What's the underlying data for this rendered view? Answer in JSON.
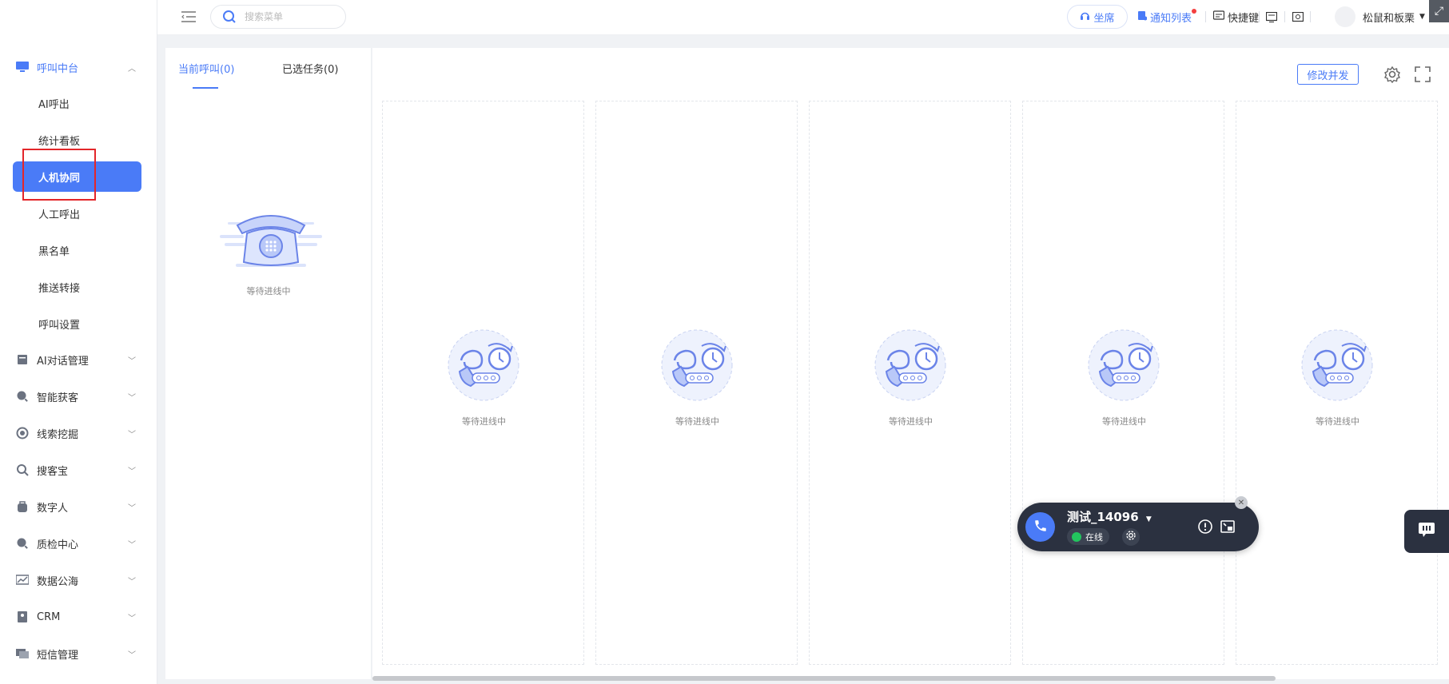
{
  "search": {
    "placeholder": "搜索菜单"
  },
  "topbar": {
    "seat_label": "坐席",
    "notify_label": "通知列表",
    "shortcut_label": "快捷键",
    "username": "松鼠和板栗"
  },
  "sidebar": {
    "items": [
      {
        "label": "呼叫中台",
        "icon": "monitor-icon",
        "expanded": true
      },
      {
        "label": "AI对话管理",
        "icon": "book-icon"
      },
      {
        "label": "智能获客",
        "icon": "search-circle-icon"
      },
      {
        "label": "线索挖掘",
        "icon": "target-icon"
      },
      {
        "label": "搜客宝",
        "icon": "zoom-icon"
      },
      {
        "label": "数字人",
        "icon": "bag-icon"
      },
      {
        "label": "质检中心",
        "icon": "check-search-icon"
      },
      {
        "label": "数据公海",
        "icon": "chart-icon"
      },
      {
        "label": "CRM",
        "icon": "contact-icon"
      },
      {
        "label": "短信管理",
        "icon": "message-icon"
      }
    ],
    "sub_items": [
      {
        "label": "AI呼出"
      },
      {
        "label": "统计看板"
      },
      {
        "label": "人机协同",
        "active": true
      },
      {
        "label": "人工呼出"
      },
      {
        "label": "黑名单"
      },
      {
        "label": "推送转接"
      },
      {
        "label": "呼叫设置"
      }
    ]
  },
  "left_panel": {
    "tabs": [
      {
        "label": "当前呼叫(0)",
        "active": true
      },
      {
        "label": "已选任务(0)"
      }
    ],
    "empty_text": "等待进线中"
  },
  "right_panel": {
    "modify_label": "修改并发",
    "columns": [
      {
        "text": "等待进线中"
      },
      {
        "text": "等待进线中"
      },
      {
        "text": "等待进线中"
      },
      {
        "text": "等待进线中"
      },
      {
        "text": "等待进线中"
      }
    ]
  },
  "call_widget": {
    "name": "测试_14096",
    "status": "在线"
  },
  "colors": {
    "accent": "#4a7bf7",
    "widget_bg": "#2b3140",
    "online": "#22c55e"
  }
}
